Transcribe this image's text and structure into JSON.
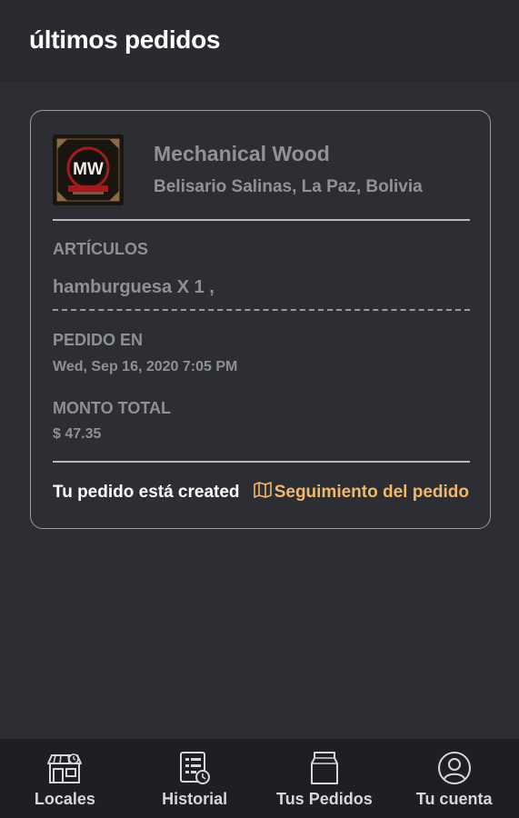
{
  "header": {
    "title": "últimos pedidos"
  },
  "order": {
    "store_name": "Mechanical Wood",
    "store_address": "Belisario Salinas, La Paz, Bolivia",
    "logo_text": "MW",
    "items_label": "ARTÍCULOS",
    "items_value": "hamburguesa X 1 ,",
    "ordered_label": "PEDIDO EN",
    "ordered_value": "Wed, Sep 16, 2020 7:05 PM",
    "total_label": "MONTO TOTAL",
    "total_value": "$ 47.35",
    "status_text": "Tu pedido está created",
    "track_label": "Seguimiento del pedido"
  },
  "nav": {
    "items": [
      {
        "label": "Locales",
        "icon": "store-icon"
      },
      {
        "label": "Historial",
        "icon": "history-icon"
      },
      {
        "label": "Tus Pedidos",
        "icon": "orders-bag-icon"
      },
      {
        "label": "Tu cuenta",
        "icon": "account-icon"
      }
    ]
  },
  "colors": {
    "background": "#2c2e33",
    "nav_background": "#1e1f22",
    "accent": "#f0b86a",
    "muted_text": "#8e9095"
  }
}
